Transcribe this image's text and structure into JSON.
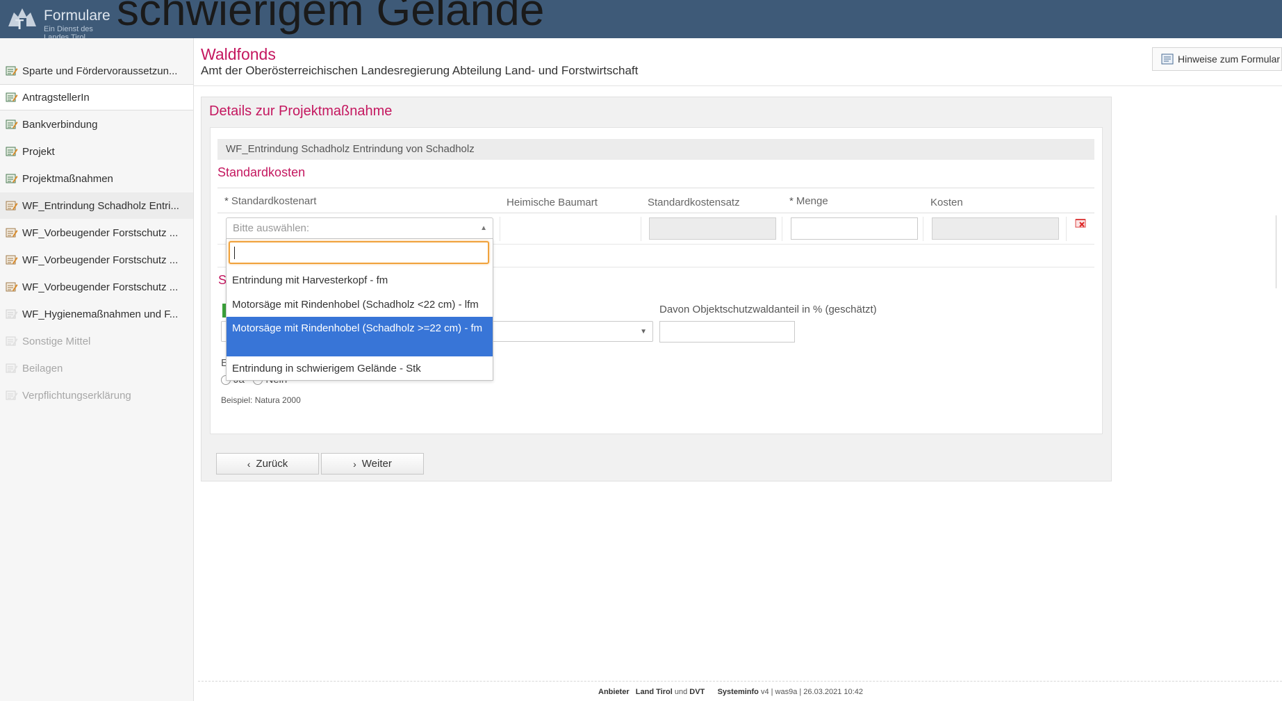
{
  "header": {
    "logo_title": "Formulare",
    "logo_subtitle": "Ein Dienst des Landes Tirol",
    "overlay_text": "schwierigem Gelände"
  },
  "sidebar": {
    "items": [
      {
        "label": "Sparte und Fördervoraussetzun..."
      },
      {
        "label": "AntragstellerIn"
      },
      {
        "label": "Bankverbindung"
      },
      {
        "label": "Projekt"
      },
      {
        "label": "Projektmaßnahmen"
      },
      {
        "label": "WF_Entrindung Schadholz Entri..."
      },
      {
        "label": "WF_Vorbeugender Forstschutz ..."
      },
      {
        "label": "WF_Vorbeugender Forstschutz ..."
      },
      {
        "label": "WF_Vorbeugender Forstschutz ..."
      },
      {
        "label": "WF_Hygienemaßnahmen und F..."
      },
      {
        "label": "Sonstige Mittel"
      },
      {
        "label": "Beilagen"
      },
      {
        "label": "Verpflichtungserklärung"
      }
    ]
  },
  "main": {
    "title": "Waldfonds",
    "subtitle": "Amt der Oberösterreichischen Landesregierung Abteilung Land- und Forstwirtschaft",
    "hinweise_label": "Hinweise zum Formular",
    "panel_title": "Details zur Projektmaßnahme",
    "measure_name": "WF_Entrindung Schadholz Entrindung von Schadholz",
    "section_title": "Standardkosten",
    "columns": {
      "standardkostenart": "Standardkostenart",
      "heimische_baumart": "Heimische Baumart",
      "standardkostensatz": "Standardkostensatz",
      "menge": "Menge",
      "kosten": "Kosten"
    },
    "required_marker": "*",
    "select_placeholder": "Bitte auswählen:",
    "dropdown_options": [
      "Entrindung mit Harvesterkopf - fm",
      "Motorsäge mit Rindenhobel (Schadholz <22 cm) - lfm",
      "Motorsäge mit Rindenhobel (Schadholz >=22 cm) - fm",
      "Entrindung in schwierigem Gelände - Stk"
    ],
    "highlighted_option_index": 2,
    "hidden_section_letter": "S",
    "objektschutz_label": "Davon Objektschutzwaldanteil in % (geschätzt)",
    "e_letter": "E",
    "radio_ja": "Ja",
    "radio_nein": "Nein",
    "hint": "Beispiel: Natura 2000",
    "back_label": "Zurück",
    "next_label": "Weiter"
  },
  "footer": {
    "anbieter_prefix": "Anbieter",
    "anbieter_land": "Land Tirol",
    "und": "und",
    "anbieter_dvt": "DVT",
    "systeminfo_label": "Systeminfo",
    "systeminfo_value": "v4 | was9a | 26.03.2021 10:42"
  },
  "colors": {
    "header_bg": "#3e5a78",
    "accent": "#c4175f",
    "highlight": "#3875d7",
    "focus": "#f0a23c"
  }
}
